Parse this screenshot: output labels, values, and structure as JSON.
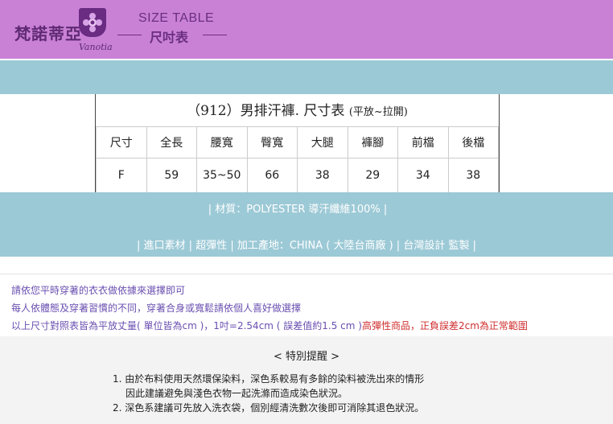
{
  "header": {
    "brand_name": "梵諾蒂亞",
    "logo_script": "Vanotia",
    "size_table_en": "SIZE TABLE",
    "size_table_zh": "尺吋表"
  },
  "size_table": {
    "title": "（912）男排汗褲. 尺寸表",
    "title_note": "(平放~拉開)",
    "headers": [
      "尺寸",
      "全長",
      "腰寬",
      "臀寬",
      "大腿",
      "褲腳",
      "前檔",
      "後檔"
    ],
    "row": [
      "F",
      "59",
      "35~50",
      "66",
      "38",
      "29",
      "34",
      "38"
    ]
  },
  "material": "|  材質：POLYESTER 導汗纖維100%   |",
  "features": "|  進口素材   |   超彈性   |   加工產地：CHINA ( 大陸台商廠 )   |   台灣設計 監製   |",
  "notes": {
    "line1": "請依您平時穿著的衣衣做依據來選擇即可",
    "line2": "每人依體態及穿著習慣的不同，穿著合身或寬鬆請依個人喜好做選擇",
    "line3_main": "以上尺寸對照表皆為平放丈量( 單位皆為cm )，1吋=2.54cm ( 誤差值約1.5 cm )",
    "line3_red": "高彈性商品，正負誤差2cm為正常範圍"
  },
  "reminder": {
    "title": "< 特別提醒 >",
    "item1": "1. 由於布料使用天然環保染料，深色系較易有多餘的染料被洗出來的情形",
    "item1b": "因此建議避免與淺色衣物一起洗滌而造成染色狀況。",
    "item2": "2. 深色系建議可先放入洗衣袋，個別經清洗數次後即可消除其退色狀況。"
  },
  "colors": {
    "header_purple": "#c981d6",
    "band_blue": "#9cc9d6",
    "note_purple": "#6a4fb0",
    "warning_red": "#d03030"
  }
}
